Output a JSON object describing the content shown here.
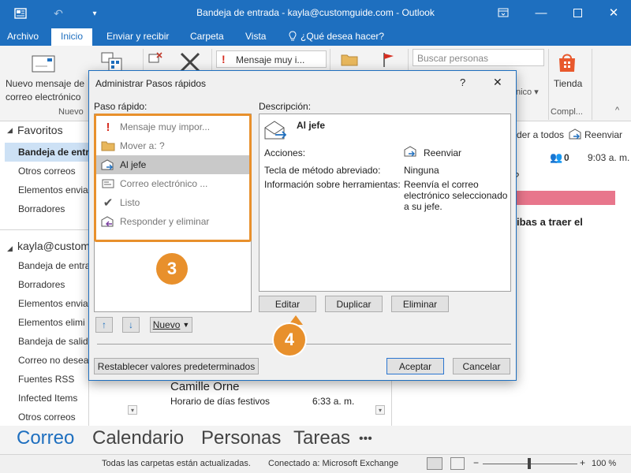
{
  "titlebar": {
    "title": "Bandeja de entrada - kayla@customguide.com - Outlook"
  },
  "ribbon_tabs": {
    "archivo": "Archivo",
    "inicio": "Inicio",
    "enviar_recibir": "Enviar y recibir",
    "carpeta": "Carpeta",
    "vista": "Vista",
    "tell_me": "¿Qué desea hacer?"
  },
  "ribbon": {
    "new_message_line1": "Nuevo mensaje de",
    "new_message_line2": "correo electrónico",
    "group_nuevo": "Nuevo",
    "quick_step_preview": "Mensaje muy i...",
    "search_people_placeholder": "Buscar personas",
    "store_label": "Tienda",
    "group_compl": "Compl..."
  },
  "leftnav": {
    "favoritos": "Favoritos",
    "favorites": [
      "Bandeja de entr",
      "Otros correos",
      "Elementos envia",
      "Borradores"
    ],
    "account": "kayla@custom",
    "folders": [
      "Bandeja de entra",
      "Borradores",
      "Elementos envia",
      "Elementos elimi",
      "Bandeja de salid",
      "Correo no desea",
      "Fuentes RSS",
      "Infected Items",
      "Otros correos"
    ]
  },
  "msglist": {
    "sender": "Camille Orne",
    "subject": "Horario de días festivos",
    "time": "6:33 a. m."
  },
  "reading": {
    "reply_all": "der a todos",
    "forward": "Reenviar",
    "people_count": "0",
    "time": "9:03 a. m.",
    "question": "?",
    "body_text": "ibas a traer el"
  },
  "bottomnav": {
    "correo": "Correo",
    "calendario": "Calendario",
    "personas": "Personas",
    "tareas": "Tareas",
    "more": "•••"
  },
  "statusbar": {
    "left": "Todas las carpetas están actualizadas.",
    "connected": "Conectado a: Microsoft Exchange",
    "zoom": "100 %"
  },
  "dialog": {
    "title": "Administrar Pasos rápidos",
    "help": "?",
    "close": "✕",
    "paso_label": "Paso rápido:",
    "desc_label": "Descripción:",
    "steps": [
      {
        "label": "Mensaje muy impor...",
        "icon": "exclamation-icon",
        "color": "#d62d20"
      },
      {
        "label": "Mover a: ?",
        "icon": "folder-icon",
        "color": "#e8b75c"
      },
      {
        "label": "Al jefe",
        "icon": "envelope-forward-icon",
        "color": "#1e6fbf"
      },
      {
        "label": "Correo electrónico ...",
        "icon": "email-card-icon",
        "color": "#555555"
      },
      {
        "label": "Listo",
        "icon": "checkmark-icon",
        "color": "#555555"
      },
      {
        "label": "Responder y eliminar",
        "icon": "envelope-reply-delete-icon",
        "color": "#7b3fa0"
      }
    ],
    "desc_title": "Al jefe",
    "acciones_label": "Acciones:",
    "acciones_value": "Reenviar",
    "tecla_label": "Tecla de método abreviado:",
    "tecla_value": "Ninguna",
    "info_label": "Información sobre herramientas:",
    "info_value_1": "Reenvía el correo",
    "info_value_2": "electrónico seleccionado",
    "info_value_3": "a su jefe.",
    "editar": "Editar",
    "duplicar": "Duplicar",
    "eliminar": "Eliminar",
    "nuevo": "Nuevo",
    "restablecer": "Restablecer valores predeterminados",
    "aceptar": "Aceptar",
    "cancelar": "Cancelar"
  },
  "callouts": {
    "three": "3",
    "four": "4"
  },
  "colors": {
    "brand_blue": "#1e6fbf",
    "callout_orange": "#e8902c",
    "highlight_pink": "#e8768c"
  }
}
